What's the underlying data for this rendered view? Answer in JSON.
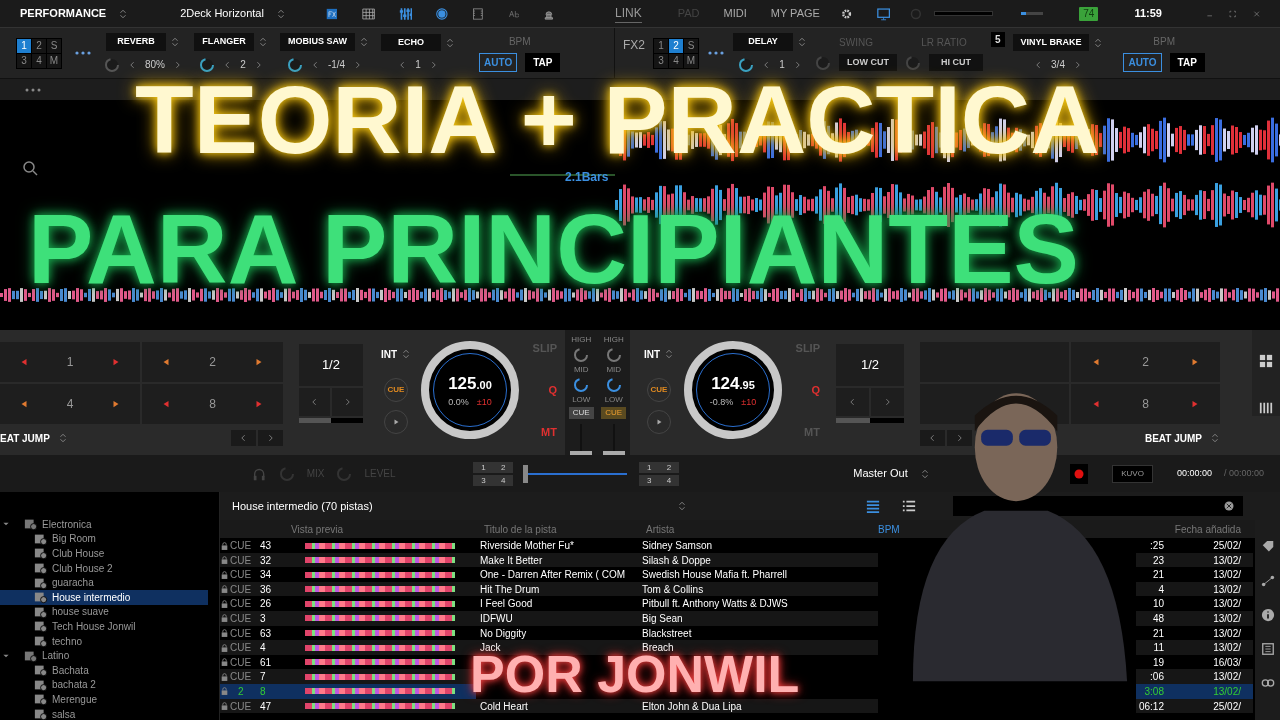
{
  "top_bar": {
    "layout": "PERFORMANCE",
    "skin": "2Deck Horizontal",
    "link": "LINK",
    "menu": [
      {
        "label": "PAD",
        "disabled": true
      },
      {
        "label": "MIDI",
        "disabled": false
      },
      {
        "label": "MY PAGE",
        "disabled": false
      }
    ],
    "volume": {
      "level": 0.2
    },
    "battery": "74",
    "time": "11:59"
  },
  "fx_left": {
    "decks": [
      {
        "label": "1",
        "selected": true
      },
      {
        "label": "2",
        "selected": false
      },
      {
        "label": "S",
        "selected": false
      },
      {
        "label": "3",
        "selected": false
      },
      {
        "label": "4",
        "selected": false
      },
      {
        "label": "M",
        "selected": false
      }
    ],
    "effects": [
      {
        "name": "REVERB",
        "value": "80%"
      },
      {
        "name": "FLANGER",
        "value": "2"
      },
      {
        "name": "MOBIUS SAW",
        "value": "-1/4"
      },
      {
        "name": "ECHO",
        "value": "1"
      }
    ],
    "bpm": "BPM",
    "auto": "AUTO",
    "tap": "TAP"
  },
  "fx_right": {
    "label": "FX2",
    "decks": [
      {
        "label": "1",
        "selected": false
      },
      {
        "label": "2",
        "selected": true
      },
      {
        "label": "S",
        "selected": false
      },
      {
        "label": "3",
        "selected": false
      },
      {
        "label": "4",
        "selected": false
      },
      {
        "label": "M",
        "selected": false
      }
    ],
    "effect": {
      "name": "DELAY",
      "value": "1"
    },
    "swing": "SWING",
    "low_cut": "LOW CUT",
    "lr_ratio": "LR RATIO",
    "hi_cut": "HI CUT",
    "count": "5",
    "brake": {
      "name": "VINYL BRAKE",
      "value": "3/4"
    },
    "bpm": "BPM",
    "auto": "AUTO",
    "tap": "TAP"
  },
  "waveforms": {
    "bars_marker": "2.1Bars"
  },
  "title": {
    "line_1": "TEORIA + PRACTICA",
    "line_2": "PARA PRINCIPIANTES",
    "byline": "POR JONWIL"
  },
  "decks": [
    {
      "kind": "left",
      "pads": [
        "1",
        "2",
        "4",
        "8"
      ],
      "beat_jump": "EAT JUMP",
      "loop": "1/2",
      "loop_progress": {
        "level": 0.5
      },
      "int": "INT",
      "slip": "SLIP",
      "q": "Q",
      "mt": "MT",
      "cue": "CUE",
      "bpm": "125",
      "bpm_decimals": ".00",
      "pitch": "0.0%",
      "range": "±10"
    },
    {
      "kind": "right",
      "pads": [
        "2",
        "8"
      ],
      "beat_jump": "BEAT JUMP",
      "loop": "1/2",
      "loop_progress": {
        "level": 0.5
      },
      "int": "INT",
      "slip": "SLIP",
      "q": "Q",
      "mt": "MT",
      "cue": "CUE",
      "bpm": "124",
      "bpm_decimals": ".95",
      "pitch": "-0.8%",
      "range": "±10"
    }
  ],
  "mixer": {
    "channels": [
      {
        "high": "HIGH",
        "mid": "MID",
        "low": "LOW",
        "cue": "CUE",
        "cue_on": false
      },
      {
        "high": "HIGH",
        "mid": "MID",
        "low": "LOW",
        "cue": "CUE",
        "cue_on": true
      }
    ]
  },
  "bottom": {
    "mix": "MIX",
    "level": "LEVEL",
    "left_buttons": [
      "1",
      "2",
      "3",
      "4"
    ],
    "right_buttons": [
      "1",
      "2",
      "3",
      "4"
    ],
    "output": "Master Out",
    "kuvo": "KUVO",
    "elapsed": "00:00:00",
    "total": "/ 00:00:00"
  },
  "browser": {
    "tree": [
      {
        "label": "Electronica",
        "children": [
          {
            "label": "Big Room",
            "selected": false
          },
          {
            "label": "Club House",
            "selected": false
          },
          {
            "label": "Club House 2",
            "selected": false
          },
          {
            "label": "guaracha",
            "selected": false
          },
          {
            "label": "House intermedio",
            "selected": true
          },
          {
            "label": "house suave",
            "selected": false
          },
          {
            "label": "Tech House Jonwil",
            "selected": false
          },
          {
            "label": "techno",
            "selected": false
          }
        ]
      },
      {
        "label": "Latino",
        "children": [
          {
            "label": "Bachata",
            "selected": false
          },
          {
            "label": "bachata 2",
            "selected": false
          },
          {
            "label": "Merengue",
            "selected": false
          },
          {
            "label": "salsa",
            "selected": false
          }
        ]
      }
    ],
    "header": "House intermedio (70 pistas)",
    "columns": [
      "Vista previa",
      "Titulo de la pista",
      "Artista",
      "BPM",
      "Fecha añadida"
    ],
    "rows": [
      {
        "cue": "CUE",
        "number": "43",
        "title": "Riverside Mother Fu*",
        "artist": "Sidney Samson",
        "time": ":25",
        "date": "25/02/",
        "selected": false
      },
      {
        "cue": "CUE",
        "number": "32",
        "title": "Make It Better",
        "artist": "Silash & Doppe",
        "time": "23",
        "date": "13/02/",
        "selected": false
      },
      {
        "cue": "CUE",
        "number": "34",
        "title": "One - Darren After Remix ( COM",
        "artist": "Swedish House Mafia ft. Pharrell",
        "time": "21",
        "date": "13/02/",
        "selected": false
      },
      {
        "cue": "CUE",
        "number": "36",
        "title": "Hit The Drum",
        "artist": "Tom & Collins",
        "time": "4",
        "date": "13/02/",
        "selected": false
      },
      {
        "cue": "CUE",
        "number": "26",
        "title": "I Feel Good",
        "artist": "Pitbull ft. Anthony Watts & DJWS",
        "time": "10",
        "date": "13/02/",
        "selected": false
      },
      {
        "cue": "CUE",
        "number": "3",
        "title": "IDFWU",
        "artist": "Big Sean",
        "time": "48",
        "date": "13/02/",
        "selected": false
      },
      {
        "cue": "CUE",
        "number": "63",
        "title": "No Diggity",
        "artist": "Blackstreet",
        "time": "21",
        "date": "13/02/",
        "selected": false
      },
      {
        "cue": "CUE",
        "number": "4",
        "title": "Jack",
        "artist": "Breach",
        "time": "11",
        "date": "13/02/",
        "selected": false
      },
      {
        "cue": "CUE",
        "number": "61",
        "time": "19",
        "date": "16/03/",
        "selected": false
      },
      {
        "cue": "CUE",
        "number": "7",
        "time": ":06",
        "date": "13/02/",
        "selected": false
      },
      {
        "cue": "2",
        "number": "8",
        "time": "3:08",
        "date": "13/02/",
        "selected": true
      },
      {
        "cue": "CUE",
        "number": "47",
        "title": "Cold Heart",
        "artist": "Elton John & Dua Lipa",
        "time": "06:12",
        "date": "25/02/",
        "selected": false
      }
    ]
  }
}
